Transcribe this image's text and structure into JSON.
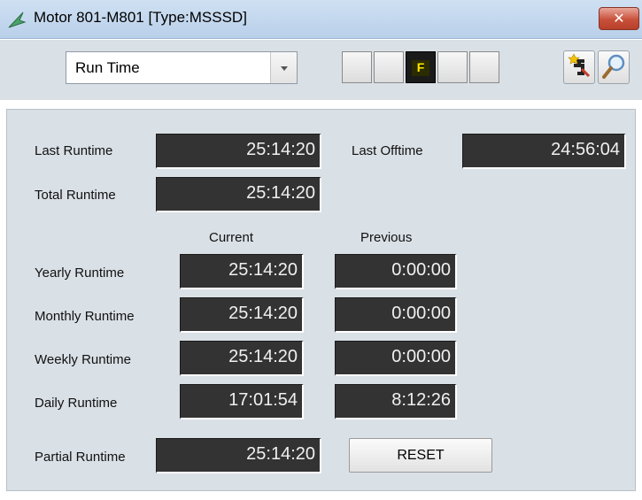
{
  "window": {
    "title": "Motor 801-M801  [Type:MSSSD]",
    "close_label": "✕"
  },
  "toolbar": {
    "view_select": {
      "value": "Run Time"
    },
    "indicators": [
      {
        "label": "",
        "active": false
      },
      {
        "label": "",
        "active": false
      },
      {
        "label": "F",
        "active": true
      },
      {
        "label": "",
        "active": false
      },
      {
        "label": "",
        "active": false
      }
    ],
    "icons": [
      "edit-parameters-icon",
      "search-icon"
    ]
  },
  "runtime": {
    "last_runtime_label": "Last Runtime",
    "last_runtime_value": "25:14:20",
    "last_offtime_label": "Last Offtime",
    "last_offtime_value": "24:56:04",
    "total_runtime_label": "Total Runtime",
    "total_runtime_value": "25:14:20",
    "current_header": "Current",
    "previous_header": "Previous",
    "rows": [
      {
        "label": "Yearly Runtime",
        "current": "25:14:20",
        "previous": "0:00:00"
      },
      {
        "label": "Monthly Runtime",
        "current": "25:14:20",
        "previous": "0:00:00"
      },
      {
        "label": "Weekly Runtime",
        "current": "25:14:20",
        "previous": "0:00:00"
      },
      {
        "label": "Daily Runtime",
        "current": "17:01:54",
        "previous": "8:12:26"
      }
    ],
    "partial_runtime_label": "Partial Runtime",
    "partial_runtime_value": "25:14:20",
    "reset_label": "RESET"
  },
  "colors": {
    "field_bg": "#333333",
    "panel_bg": "#d9e0e6",
    "indicator_active_text": "#ffe800"
  }
}
